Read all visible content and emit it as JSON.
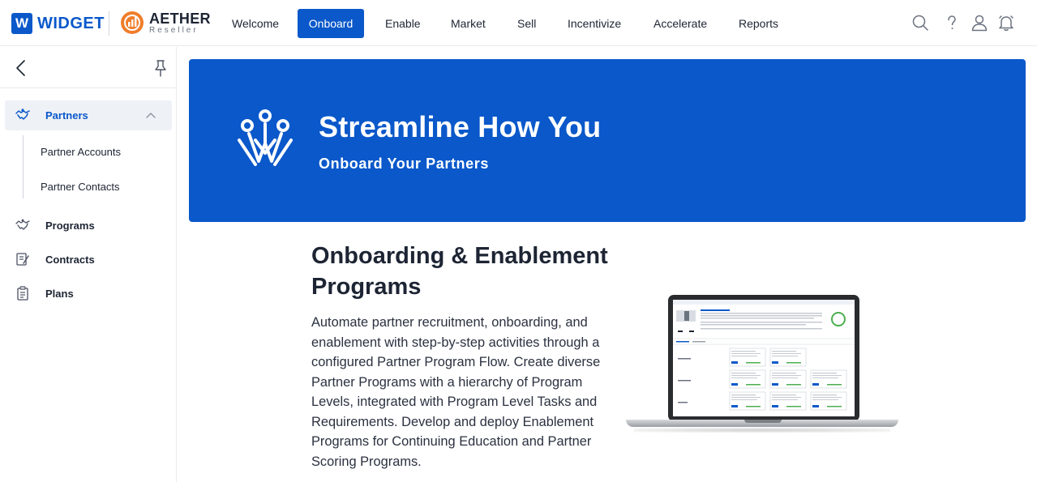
{
  "header": {
    "brand_widget_letter": "W",
    "brand_widget_name": "WIDGET",
    "brand_reseller_name": "AETHER",
    "brand_reseller_sub": "Reseller",
    "nav": [
      {
        "label": "Welcome"
      },
      {
        "label": "Onboard",
        "active": true
      },
      {
        "label": "Enable"
      },
      {
        "label": "Market"
      },
      {
        "label": "Sell"
      },
      {
        "label": "Incentivize"
      },
      {
        "label": "Accelerate"
      },
      {
        "label": "Reports"
      }
    ],
    "icons": [
      "search-icon",
      "help-icon",
      "user-icon",
      "notification-bell-icon"
    ]
  },
  "sidebar": {
    "items": [
      {
        "label": "Partners",
        "icon": "handshake-icon",
        "active": true,
        "expanded": true,
        "children": [
          {
            "label": "Partner Accounts"
          },
          {
            "label": "Partner Contacts"
          }
        ]
      },
      {
        "label": "Programs",
        "icon": "handshake-icon"
      },
      {
        "label": "Contracts",
        "icon": "contract-icon"
      },
      {
        "label": "Plans",
        "icon": "clipboard-icon"
      }
    ]
  },
  "hero": {
    "title": "Streamline How You",
    "subtitle": "Onboard Your Partners"
  },
  "content": {
    "title": "Onboarding & Enablement Programs",
    "body": "Automate partner recruitment, onboarding, and enablement with step-by-step activities through a configured Partner Program Flow. Create diverse Partner Programs with a hierarchy of Program Levels, integrated with Program Level Tasks and Requirements. Develop and deploy Enablement Programs for Continuing Education and Partner Scoring Programs."
  },
  "colors": {
    "accent": "#0a58ca",
    "active_item_bg": "#eef1f6",
    "reseller_orange": "#f07d2a"
  }
}
